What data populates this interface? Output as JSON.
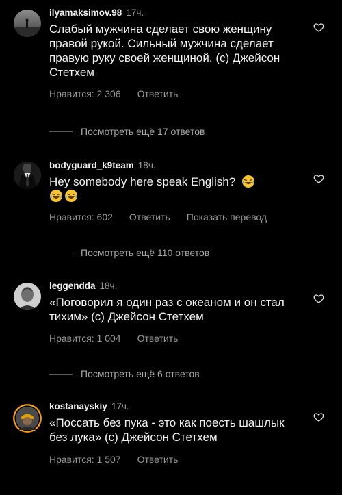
{
  "comments": [
    {
      "username": "ilyamaksimov.98",
      "time": "17ч.",
      "text": "Слабый мужчина сделает свою женщину правой рукой. Сильный мужчина сделает правую руку своей женщиной. (с) Джейсон Стетхем",
      "likes": "Нравится: 2 306",
      "reply": "Ответить",
      "more_replies": "Посмотреть ещё 17 ответов"
    },
    {
      "username": "bodyguard_k9team",
      "time": "18ч.",
      "text": "Hey somebody here speak English?",
      "likes": "Нравится: 602",
      "reply": "Ответить",
      "translate": "Показать перевод",
      "more_replies": "Посмотреть ещё 110 ответов"
    },
    {
      "username": "leggendda",
      "time": "18ч.",
      "text": "«Поговорил я один раз с океаном и он стал тихим» (с) Джейсон Стетхем",
      "likes": "Нравится: 1 004",
      "reply": "Ответить",
      "more_replies": "Посмотреть ещё 6 ответов"
    },
    {
      "username": "kostanayskiy",
      "time": "17ч.",
      "text": "«Поссать без пука - это как поесть шашлык без лука» (с) Джейсон Стетхем",
      "likes": "Нравится: 1 507",
      "reply": "Ответить"
    }
  ],
  "icons": {
    "like": "heart-outline-icon",
    "laugh": "laughing-crying-emoji"
  },
  "colors": {
    "background": "#000000",
    "text": "#f2f2f2",
    "muted": "#9a9a9a"
  }
}
